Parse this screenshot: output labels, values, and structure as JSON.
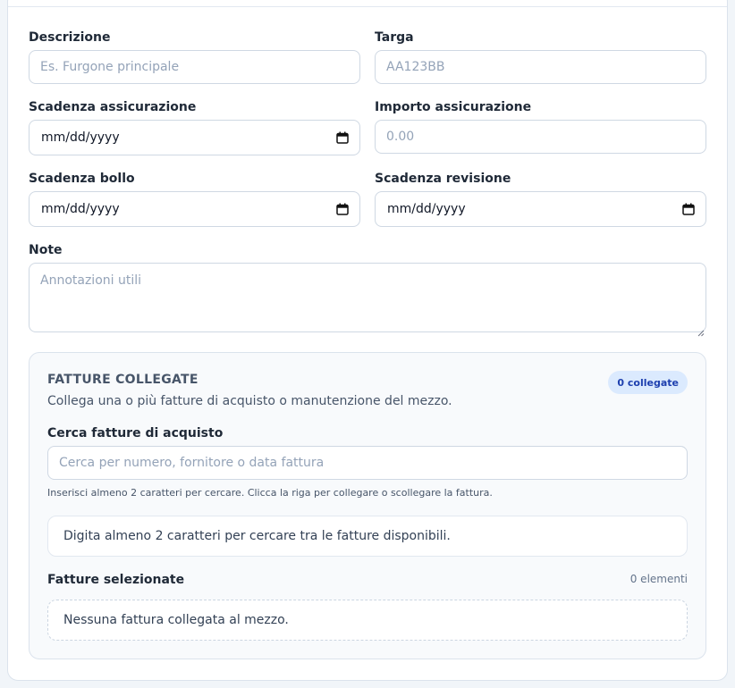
{
  "form": {
    "descrizione": {
      "label": "Descrizione",
      "placeholder": "Es. Furgone principale"
    },
    "targa": {
      "label": "Targa",
      "placeholder": "AA123BB"
    },
    "scadenza_assicurazione": {
      "label": "Scadenza assicurazione",
      "value": "mm/dd/yyyy"
    },
    "importo_assicurazione": {
      "label": "Importo assicurazione",
      "placeholder": "0.00"
    },
    "scadenza_bollo": {
      "label": "Scadenza bollo",
      "value": "mm/dd/yyyy"
    },
    "scadenza_revisione": {
      "label": "Scadenza revisione",
      "value": "mm/dd/yyyy"
    },
    "note": {
      "label": "Note",
      "placeholder": "Annotazioni utili"
    }
  },
  "invoices_panel": {
    "title": "FATTURE COLLEGATE",
    "badge": "0 collegate",
    "description": "Collega una o più fatture di acquisto o manutenzione del mezzo.",
    "search_label": "Cerca fatture di acquisto",
    "search_placeholder": "Cerca per numero, fornitore o data fattura",
    "hint": "Inserisci almeno 2 caratteri per cercare. Clicca la riga per collegare o scollegare la fattura.",
    "results_message": "Digita almeno 2 caratteri per cercare tra le fatture disponibili.",
    "selected_label": "Fatture selezionate",
    "selected_count": "0 elementi",
    "empty_message": "Nessuna fattura collegata al mezzo."
  },
  "icons": {
    "date": "calendar-icon"
  },
  "colors": {
    "badge_bg": "#dbeafe",
    "badge_text": "#1e40af",
    "panel_bg": "#f8fafc"
  }
}
